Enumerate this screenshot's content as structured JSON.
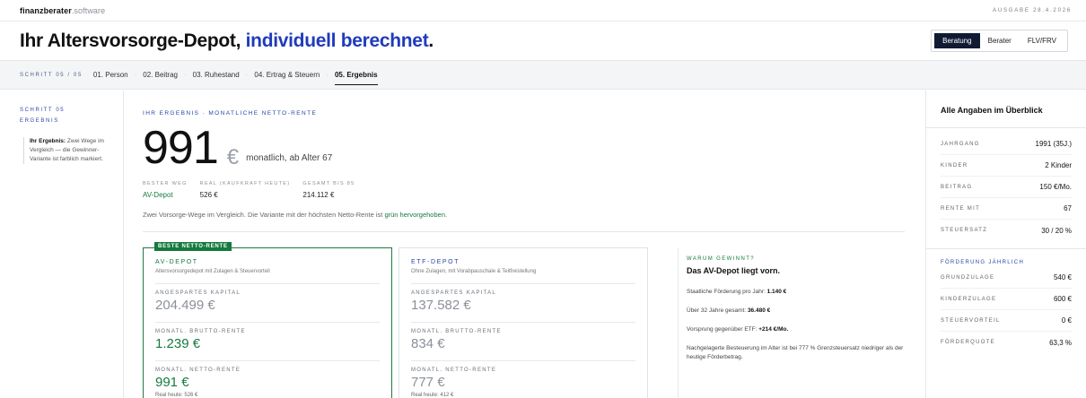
{
  "brand": {
    "bold": "finanzberater",
    "light": ".software"
  },
  "edition": "AUSGABE 28.4.2026",
  "headline": {
    "part1": "Ihr Altersvorsorge-Depot, ",
    "accent": "individuell berechnet",
    "end": "."
  },
  "seg": [
    "Beratung",
    "Berater",
    "FLV/FRV"
  ],
  "steps": {
    "count": "SCHRITT 05 / 05",
    "items": [
      "01. Person",
      "02. Beitrag",
      "03. Ruhestand",
      "04. Ertrag & Steuern",
      "05. Ergebnis"
    ]
  },
  "left": {
    "line1": "SCHRITT 05",
    "line2": "ERGEBNIS",
    "note_bold": "Ihr Ergebnis:",
    "note_text": " Zwei Wege im Vergleich — die Gewinner-Variante ist farblich markiert."
  },
  "result": {
    "kicker": "IHR ERGEBNIS · MONATLICHE NETTO-RENTE",
    "big": "991",
    "currency": "€",
    "monthly": "monatlich, ab Alter 67",
    "metrics": [
      {
        "label": "BESTER WEG",
        "value": "AV-Depot"
      },
      {
        "label": "REAL (KAUFKRAFT HEUTE)",
        "value": "526 €"
      },
      {
        "label": "GESAMT BIS 85",
        "value": "214.112 €"
      }
    ],
    "intro_text": "Zwei Vorsorge-Wege im Vergleich. Die Variante mit der höchsten Netto-Rente ist ",
    "intro_green": "grün hervorgehoben",
    "intro_end": "."
  },
  "cards": [
    {
      "badge": "BESTE NETTO-RENTE",
      "name": "AV-DEPOT",
      "sub": "Altersvorsorgedepot mit Zulagen & Steuervorteil",
      "rows": [
        {
          "label": "ANGESPARTES KAPITAL",
          "value": "204.499 €"
        },
        {
          "label": "MONATL. BRUTTO-RENTE",
          "value": "1.239 €"
        },
        {
          "label": "MONATL. NETTO-RENTE",
          "value": "991 €",
          "small": "Real heute: 526 €"
        }
      ]
    },
    {
      "name": "ETF-DEPOT",
      "sub": "Ohne Zulagen, mit Vorabpauschale & Teilfreistellung",
      "rows": [
        {
          "label": "ANGESPARTES KAPITAL",
          "value": "137.582 €"
        },
        {
          "label": "MONATL. BRUTTO-RENTE",
          "value": "834 €"
        },
        {
          "label": "MONATL. NETTO-RENTE",
          "value": "777 €",
          "small": "Real heute: 412 €"
        }
      ]
    }
  ],
  "why": {
    "kicker": "WARUM GEWINNT?",
    "title": "Das AV-Depot liegt vorn.",
    "l1_text": "Staatliche Förderung pro Jahr: ",
    "l1_bold": "1.140 €",
    "l2_text": "Über 32 Jahre gesamt: ",
    "l2_bold": "36.480 €",
    "l3_text": "Vorsprung gegenüber ETF: ",
    "l3_bold": "+214 €/Mo.",
    "l4": "Nachgelagerte Besteuerung im Alter ist bei 777 % Grenzsteuersatz niedriger als der heutige Förderbetrag."
  },
  "overview": {
    "title": "Alle Angaben im Überblick",
    "items": [
      {
        "k": "JAHRGANG",
        "v": "1991 (35J.)"
      },
      {
        "k": "KINDER",
        "v": "2 Kinder"
      },
      {
        "k": "BEITRAG",
        "v": "150 €/Mo."
      },
      {
        "k": "RENTE MIT",
        "v": "67"
      },
      {
        "k": "STEUERSATZ",
        "v": "30 / 20 %"
      }
    ],
    "section2": "FÖRDERUNG JÄHRLICH",
    "items2": [
      {
        "k": "GRUNDZULAGE",
        "v": "540 €"
      },
      {
        "k": "KINDERZULAGE",
        "v": "600 €"
      },
      {
        "k": "STEUERVORTEIL",
        "v": "0 €"
      },
      {
        "k": "FÖRDERQUOTE",
        "v": "63,3 %"
      }
    ]
  }
}
